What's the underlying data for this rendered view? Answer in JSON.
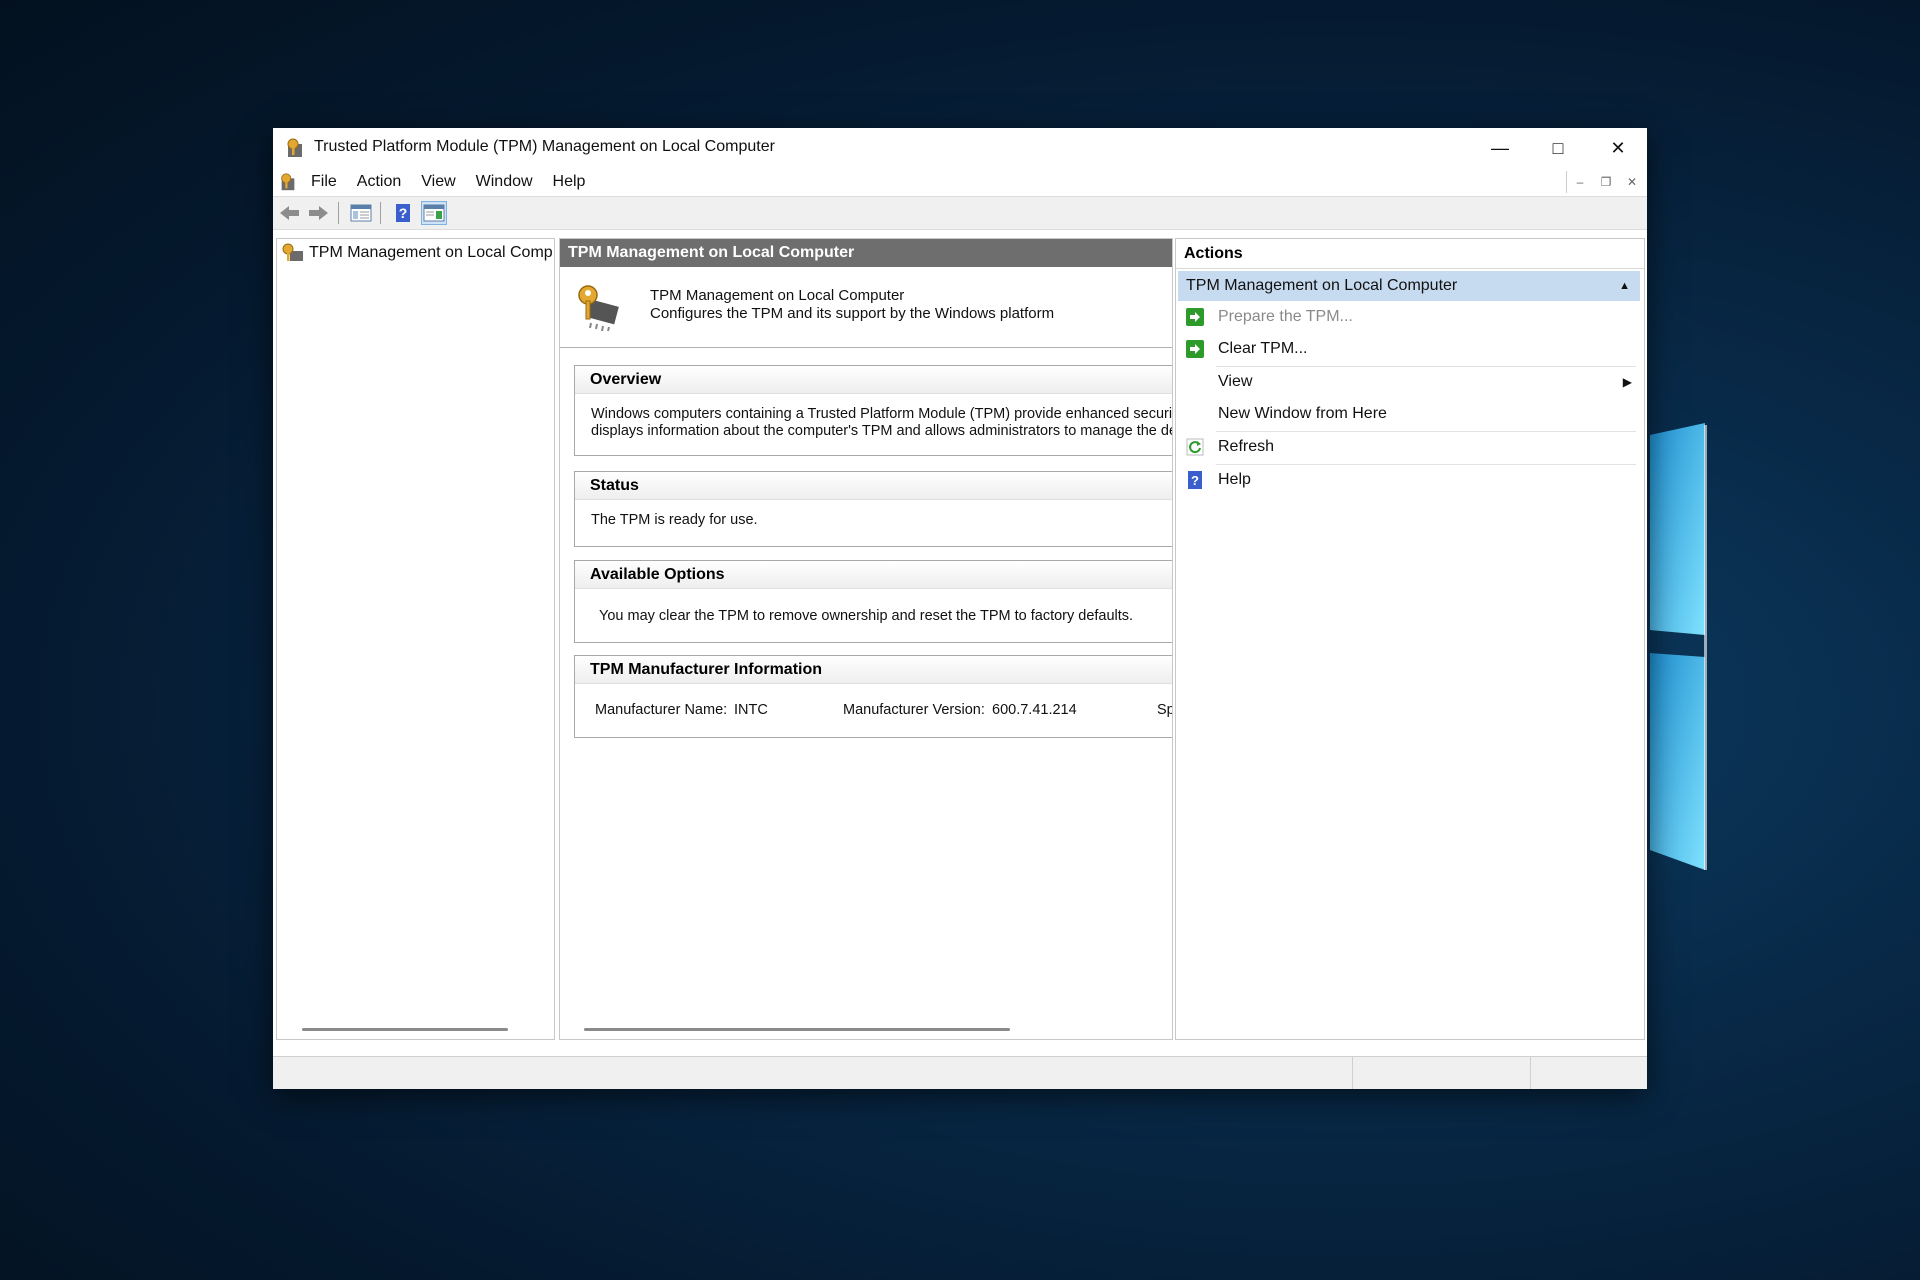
{
  "window": {
    "title": "Trusted Platform Module (TPM) Management on Local Computer",
    "caption": {
      "minimize": "—",
      "maximize": "□",
      "close": "✕"
    }
  },
  "menu": {
    "items": [
      "File",
      "Action",
      "View",
      "Window",
      "Help"
    ],
    "mdi": {
      "minimize": "–",
      "restore": "❐",
      "close": "✕"
    }
  },
  "toolbar": {
    "icons": [
      "back-arrow-icon",
      "forward-arrow-icon",
      "show-hide-console-tree-icon",
      "help-icon",
      "show-hide-action-pane-icon"
    ]
  },
  "tree": {
    "root_label": "TPM Management on Local Comp"
  },
  "main": {
    "header": "TPM Management on Local Computer",
    "intro": {
      "title": "TPM Management on Local Computer",
      "subtitle": "Configures the TPM and its support by the Windows platform"
    },
    "overview": {
      "heading": "Overview",
      "line1": "Windows computers containing a Trusted Platform Module (TPM) provide enhanced security",
      "line2": "displays information about the computer's TPM and allows administrators to manage the devi"
    },
    "status": {
      "heading": "Status",
      "text": "The TPM is ready for use."
    },
    "options": {
      "heading": "Available Options",
      "text": "You may clear the TPM to remove ownership and reset the TPM to factory defaults."
    },
    "manufacturer": {
      "heading": "TPM Manufacturer Information",
      "name_label": "Manufacturer Name:",
      "name_value": "INTC",
      "version_label": "Manufacturer Version:",
      "version_value": "600.7.41.214",
      "spec_label": "Sp"
    }
  },
  "actions": {
    "header": "Actions",
    "group": "TPM Management on Local Computer",
    "items": [
      {
        "label": "Prepare the TPM...",
        "icon": "green-arrow-icon",
        "enabled": false
      },
      {
        "label": "Clear TPM...",
        "icon": "green-arrow-icon",
        "enabled": true
      },
      {
        "label": "View",
        "icon": "",
        "enabled": true,
        "submenu": true
      },
      {
        "label": "New Window from Here",
        "icon": "",
        "enabled": true
      },
      {
        "label": "Refresh",
        "icon": "refresh-icon",
        "enabled": true
      },
      {
        "label": "Help",
        "icon": "help-icon",
        "enabled": true
      }
    ]
  },
  "colors": {
    "header_gray": "#6e6e6e",
    "selection_blue": "#c7dbf0",
    "action_green": "#2c9b2c",
    "help_blue": "#3a5fcd"
  }
}
